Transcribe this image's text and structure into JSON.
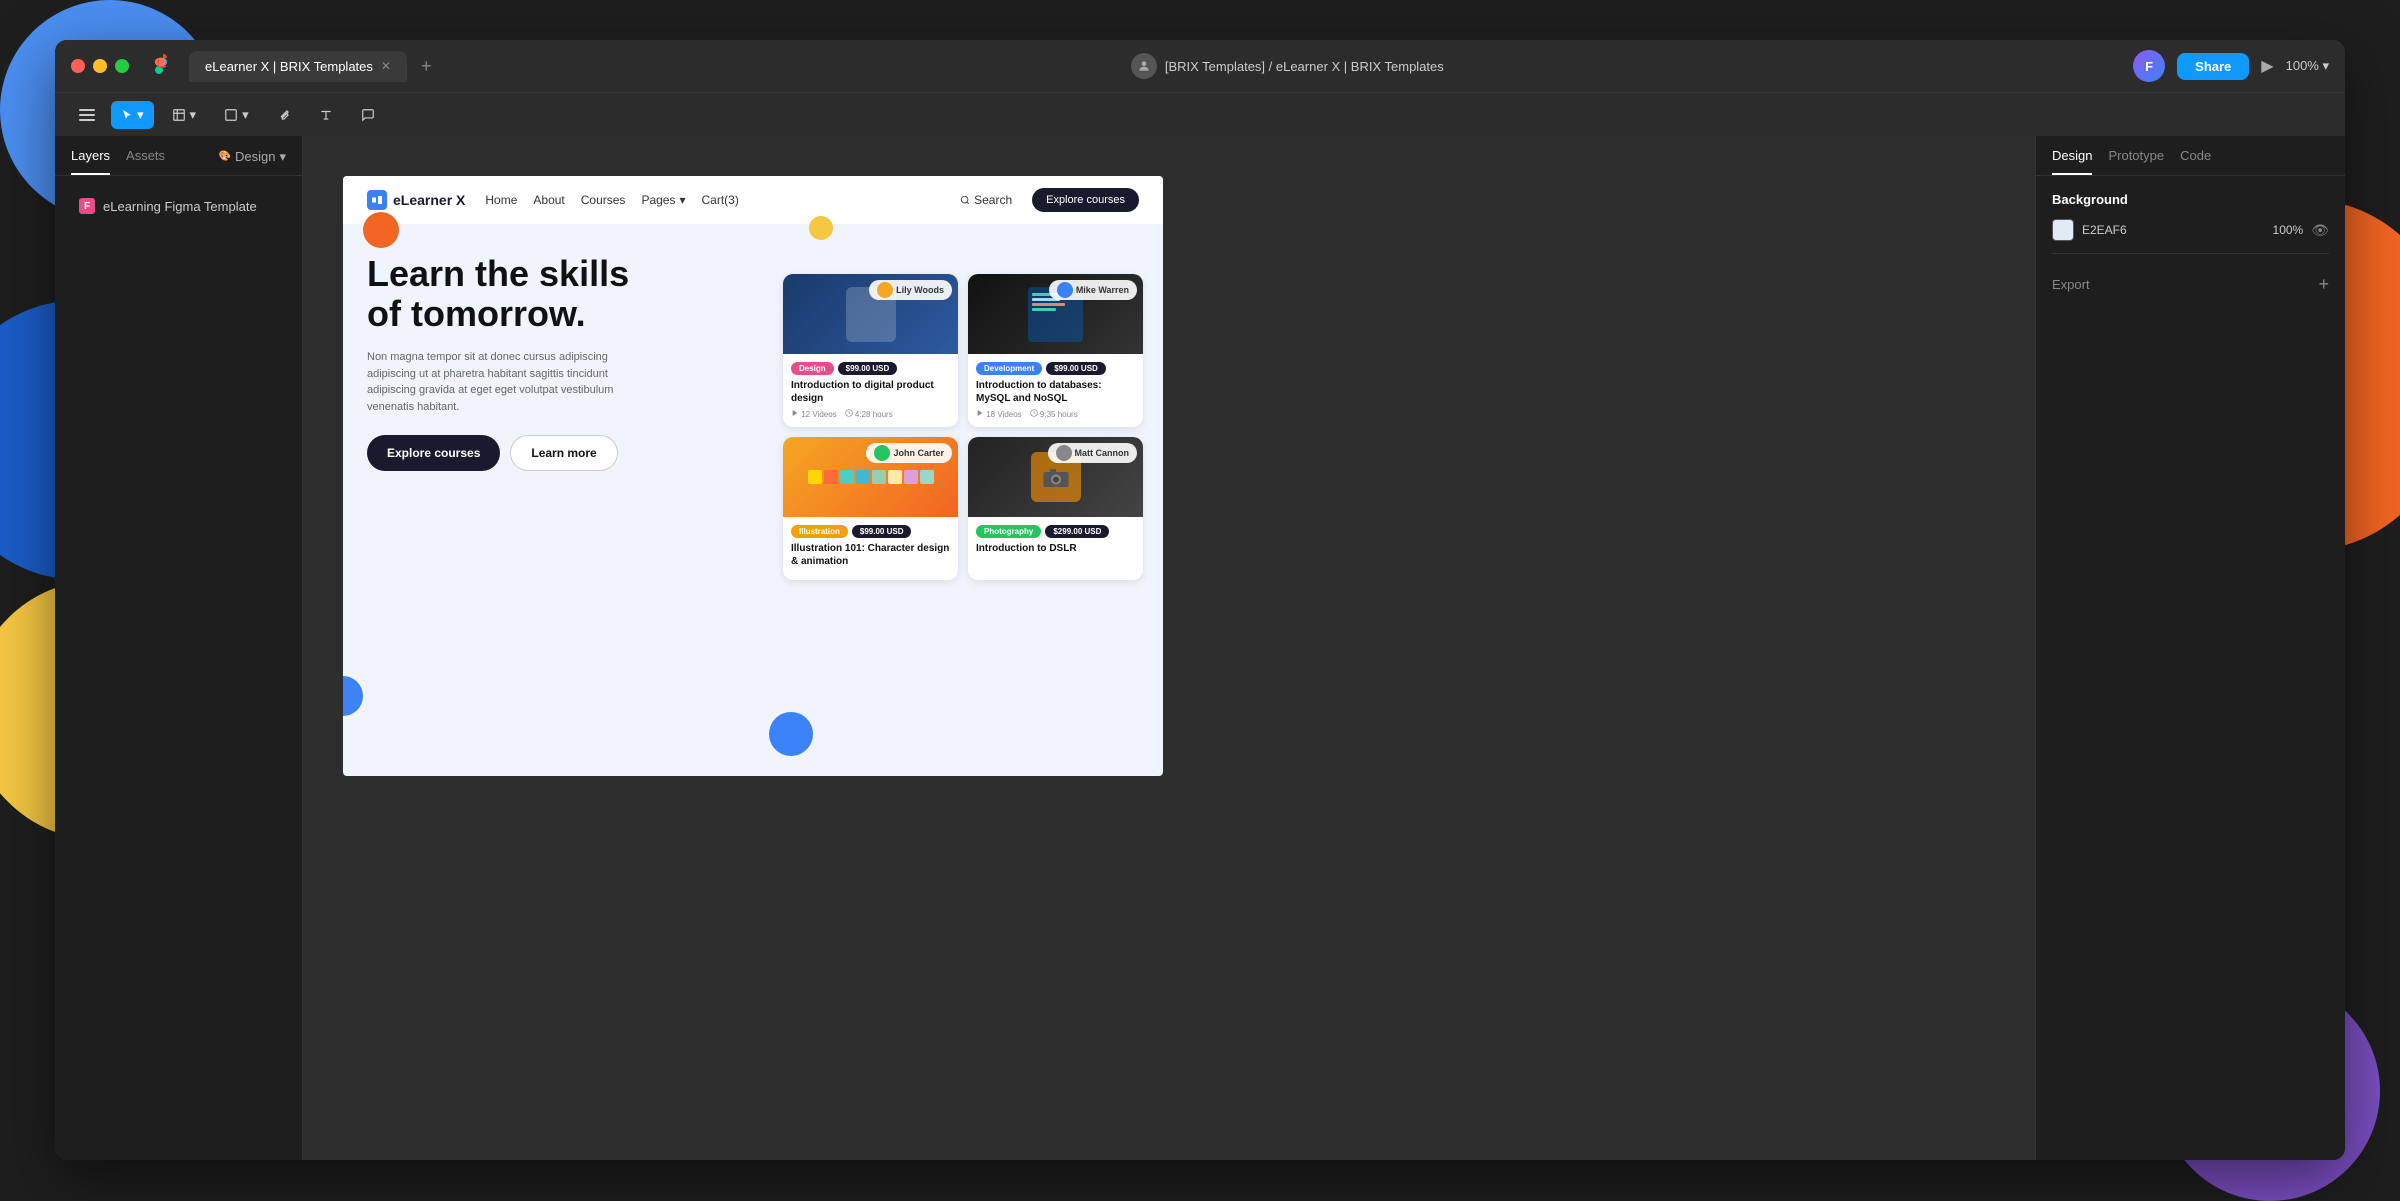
{
  "window": {
    "title": "eLearner X | BRIX Templates",
    "tab_label": "eLearner X | BRIX Templates",
    "zoom": "100%"
  },
  "titlebar": {
    "figma_logo": "🎨",
    "breadcrumb": "[BRIX Templates] / eLearner X | BRIX Templates",
    "share_btn": "Share",
    "zoom_label": "100%"
  },
  "toolbar": {
    "tools": [
      "Move",
      "Frame",
      "Rectangle",
      "Pen",
      "Text",
      "Comment"
    ]
  },
  "left_sidebar": {
    "tabs": [
      "Layers",
      "Assets"
    ],
    "design_label": "Design",
    "layer_item": "eLearning Figma Template"
  },
  "site": {
    "logo": "eLearner X",
    "nav": {
      "home": "Home",
      "about": "About",
      "courses": "Courses",
      "pages": "Pages",
      "cart": "Cart(3)",
      "search": "Search",
      "explore_btn": "Explore courses"
    },
    "hero": {
      "title_line1": "Learn the skills",
      "title_line2": "of tomorrow.",
      "subtitle": "Non magna tempor sit at donec cursus adipiscing adipiscing ut at pharetra habitant sagittis tincidunt adipiscing gravida at eget eget volutpat vestibulum venenatis habitant.",
      "btn_primary": "Explore courses",
      "btn_secondary": "Learn more"
    },
    "cards": [
      {
        "author": "Lily Woods",
        "tag": "Design",
        "tag_class": "tag-design",
        "price": "$99.00 USD",
        "title": "Introduction to digital product design",
        "videos": "12 Videos",
        "duration": "4:28 hours",
        "img_type": "phone"
      },
      {
        "author": "Mike Warren",
        "tag": "Development",
        "tag_class": "tag-dev",
        "price": "$99.00 USD",
        "title": "Introduction to databases: MySQL and NoSQL",
        "videos": "18 Videos",
        "duration": "9:35 hours",
        "img_type": "code"
      },
      {
        "author": "John Carter",
        "tag": "Illustration",
        "tag_class": "tag-illustration",
        "price": "$99.00 USD",
        "title": "Illustration 101: Character design & animation",
        "videos": "",
        "duration": "",
        "img_type": "colors"
      },
      {
        "author": "Matt Cannon",
        "tag": "Photography",
        "tag_class": "tag-photography",
        "price": "$299.00 USD",
        "title": "Introduction to DSLR",
        "videos": "",
        "duration": "",
        "img_type": "camera"
      }
    ]
  },
  "right_sidebar": {
    "tabs": [
      "Design",
      "Prototype",
      "Code"
    ],
    "background_label": "Background",
    "color_hex": "E2EAF6",
    "opacity": "100%",
    "export_label": "Export"
  }
}
